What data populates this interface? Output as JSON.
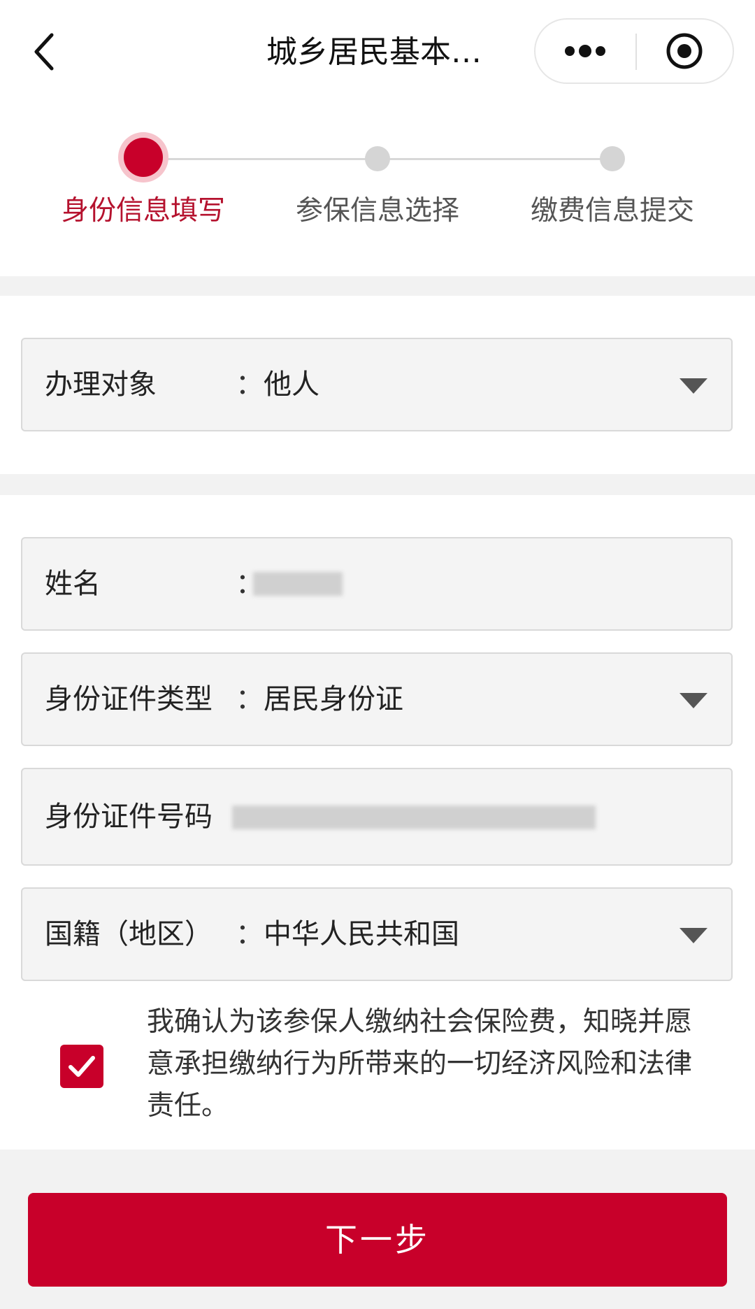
{
  "nav": {
    "title": "城乡居民基本…"
  },
  "stepper": {
    "steps": [
      {
        "label": "身份信息填写"
      },
      {
        "label": "参保信息选择"
      },
      {
        "label": "缴费信息提交"
      }
    ]
  },
  "form": {
    "target": {
      "label": "办理对象",
      "colon": "：",
      "value": "他人"
    },
    "name": {
      "label": "姓名",
      "colon": "："
    },
    "id_type": {
      "label": "身份证件类型",
      "colon": "：",
      "value": "居民身份证"
    },
    "id_number": {
      "label": "身份证件号码"
    },
    "nationality": {
      "label": "国籍（地区）",
      "colon": "：",
      "value": "中华人民共和国"
    }
  },
  "consent": {
    "text": "我确认为该参保人缴纳社会保险费，知晓并愿意承担缴纳行为所带来的一切经济风险和法律责任。"
  },
  "actions": {
    "next_label": "下一步"
  },
  "colors": {
    "accent": "#c8002a",
    "active_step_text": "#b5122e",
    "inactive_dot": "#d5d5d5"
  },
  "icons": [
    "back-icon",
    "more-icon",
    "close-target-icon",
    "dropdown-arrow-icon",
    "checkmark-icon"
  ]
}
